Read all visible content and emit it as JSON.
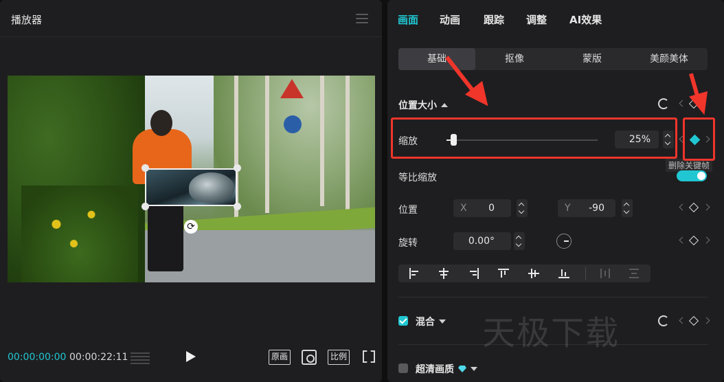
{
  "player": {
    "title": "播放器",
    "timecode_current": "00:00:00:00",
    "timecode_total": "00:00:22:11",
    "btn_original": "原画",
    "btn_ratio": "比例"
  },
  "props": {
    "tabs": [
      "画面",
      "动画",
      "跟踪",
      "调整",
      "AI效果"
    ],
    "subtabs": [
      "基础",
      "抠像",
      "蒙版",
      "美颜美体"
    ],
    "section_position_size": "位置大小",
    "scale": {
      "label": "缩放",
      "value": "25%",
      "level_percent": 25
    },
    "uniform_scale_label": "等比缩放",
    "position": {
      "label": "位置",
      "x_prefix": "X",
      "x_value": "0",
      "y_prefix": "Y",
      "y_value": "-90"
    },
    "rotation": {
      "label": "旋转",
      "value": "0.00°"
    },
    "blend_label": "混合",
    "hd_label": "超清画质",
    "tooltip": "删除关键帧",
    "watermark": "天极下载"
  },
  "colors": {
    "accent": "#20c7d2",
    "annotation": "#f0352b"
  }
}
